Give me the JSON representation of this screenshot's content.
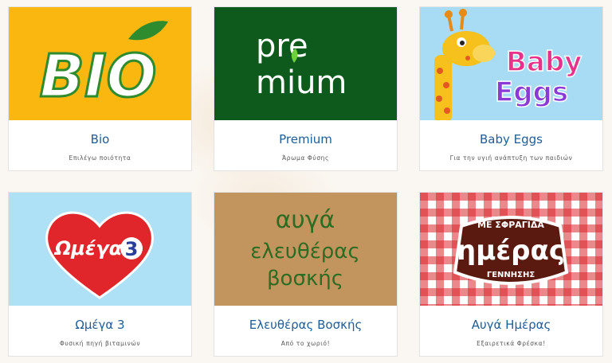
{
  "products": [
    {
      "title": "Bio",
      "subtitle": "Επιλέγω ποιότητα",
      "logo_text": "BIO"
    },
    {
      "title": "Premium",
      "subtitle": "Άρωμα Φύσης",
      "logo_line1": "pre",
      "logo_line2": "mium"
    },
    {
      "title": "Baby Eggs",
      "subtitle": "Για την υγιή ανάπτυξη των παιδιών",
      "logo_line1": "Baby",
      "logo_line2": "Eggs"
    },
    {
      "title": "Ωμέγα 3",
      "subtitle": "Φυσική πηγή βιταμινών",
      "logo_text": "Ωμέγα",
      "logo_number": "3"
    },
    {
      "title": "Ελευθέρας Βοσκής",
      "subtitle": "Από το χωριό!",
      "logo_line1": "αυγά",
      "logo_line2": "ελευθέρας",
      "logo_line3": "βοσκής"
    },
    {
      "title": "Αυγά Ημέρας",
      "subtitle": "Εξαιρετικά Φρέσκα!",
      "logo_top": "ΜΕ ΣΦΡΑΓΙΔΑ",
      "logo_main": "ημέρας",
      "logo_bottom": "ΓΕΝΝΗΣΗΣ"
    }
  ],
  "colors": {
    "title": "#1f5d96",
    "bio_bg": "#f9b70f",
    "premium_bg": "#0e5a1c",
    "baby_bg": "#a8dbf4",
    "omega_bg": "#aee0f6",
    "omega_heart": "#e0262a",
    "kraft_bg": "#c89a63",
    "gingham_red": "#d9262c"
  }
}
